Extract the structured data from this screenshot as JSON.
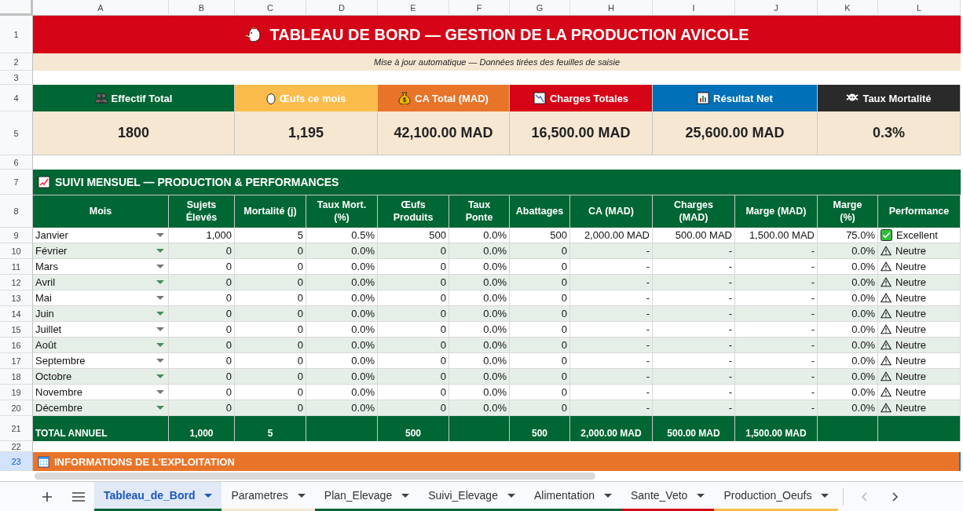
{
  "columns": [
    "A",
    "B",
    "C",
    "D",
    "E",
    "F",
    "G",
    "H",
    "I",
    "J",
    "K",
    "L"
  ],
  "row_numbers": [
    {
      "label": "1",
      "selected": false
    },
    {
      "label": "2",
      "selected": false
    },
    {
      "label": "3",
      "selected": false
    },
    {
      "label": "4",
      "selected": false
    },
    {
      "label": "5",
      "selected": false
    },
    {
      "label": "6",
      "selected": false
    },
    {
      "label": "7",
      "selected": false
    },
    {
      "label": "8",
      "selected": false
    },
    {
      "label": "9",
      "selected": false
    },
    {
      "label": "10",
      "selected": false
    },
    {
      "label": "11",
      "selected": false
    },
    {
      "label": "12",
      "selected": false
    },
    {
      "label": "13",
      "selected": false
    },
    {
      "label": "14",
      "selected": false
    },
    {
      "label": "15",
      "selected": false
    },
    {
      "label": "16",
      "selected": false
    },
    {
      "label": "17",
      "selected": false
    },
    {
      "label": "18",
      "selected": false
    },
    {
      "label": "19",
      "selected": false
    },
    {
      "label": "20",
      "selected": false
    },
    {
      "label": "21",
      "selected": false
    },
    {
      "label": "22",
      "selected": false
    },
    {
      "label": "23",
      "selected": true
    }
  ],
  "title": "TABLEAU DE BORD — GESTION DE LA PRODUCTION AVICOLE",
  "subtitle": "Mise à jour automatique — Données tirées des feuilles de saisie",
  "kpis": [
    {
      "label": "Effectif Total",
      "value": "1800",
      "color": "#006633"
    },
    {
      "label": "Œufs ce mois",
      "value": "1,195",
      "color": "#fbbc4c"
    },
    {
      "label": "CA Total (MAD)",
      "value": "42,100.00 MAD",
      "color": "#e8742a"
    },
    {
      "label": "Charges Totales",
      "value": "16,500.00 MAD",
      "color": "#d50416"
    },
    {
      "label": "Résultat Net",
      "value": "25,600.00 MAD",
      "color": "#0070b8"
    },
    {
      "label": "Taux Mortalité",
      "value": "0.3%",
      "color": "#2a2a2a"
    }
  ],
  "section_title": "SUIVI MENSUEL — PRODUCTION & PERFORMANCES",
  "table": {
    "columns": [
      "Mois",
      "Sujets Élevés",
      "Mortalité (j)",
      "Taux Mort. (%)",
      "Œufs Produits",
      "Taux Ponte",
      "Abattages",
      "CA (MAD)",
      "Charges (MAD)",
      "Marge (MAD)",
      "Marge (%)",
      "Performance"
    ],
    "rows": [
      {
        "cells": [
          "Janvier",
          "1,000",
          "5",
          "0.5%",
          "500",
          "0.0%",
          "500",
          "2,000.00 MAD",
          "500.00 MAD",
          "1,500.00 MAD",
          "75.0%"
        ],
        "performance": {
          "label": "Excellent",
          "kind": "excellent"
        }
      },
      {
        "cells": [
          "Février",
          "0",
          "0",
          "0.0%",
          "0",
          "0.0%",
          "0",
          "-",
          "-",
          "-",
          "0.0%"
        ],
        "performance": {
          "label": "Neutre",
          "kind": "neutral"
        }
      },
      {
        "cells": [
          "Mars",
          "0",
          "0",
          "0.0%",
          "0",
          "0.0%",
          "0",
          "-",
          "-",
          "-",
          "0.0%"
        ],
        "performance": {
          "label": "Neutre",
          "kind": "neutral"
        }
      },
      {
        "cells": [
          "Avril",
          "0",
          "0",
          "0.0%",
          "0",
          "0.0%",
          "0",
          "-",
          "-",
          "-",
          "0.0%"
        ],
        "performance": {
          "label": "Neutre",
          "kind": "neutral"
        }
      },
      {
        "cells": [
          "Mai",
          "0",
          "0",
          "0.0%",
          "0",
          "0.0%",
          "0",
          "-",
          "-",
          "-",
          "0.0%"
        ],
        "performance": {
          "label": "Neutre",
          "kind": "neutral"
        }
      },
      {
        "cells": [
          "Juin",
          "0",
          "0",
          "0.0%",
          "0",
          "0.0%",
          "0",
          "-",
          "-",
          "-",
          "0.0%"
        ],
        "performance": {
          "label": "Neutre",
          "kind": "neutral"
        }
      },
      {
        "cells": [
          "Juillet",
          "0",
          "0",
          "0.0%",
          "0",
          "0.0%",
          "0",
          "-",
          "-",
          "-",
          "0.0%"
        ],
        "performance": {
          "label": "Neutre",
          "kind": "neutral"
        }
      },
      {
        "cells": [
          "Août",
          "0",
          "0",
          "0.0%",
          "0",
          "0.0%",
          "0",
          "-",
          "-",
          "-",
          "0.0%"
        ],
        "performance": {
          "label": "Neutre",
          "kind": "neutral"
        }
      },
      {
        "cells": [
          "Septembre",
          "0",
          "0",
          "0.0%",
          "0",
          "0.0%",
          "0",
          "-",
          "-",
          "-",
          "0.0%"
        ],
        "performance": {
          "label": "Neutre",
          "kind": "neutral"
        }
      },
      {
        "cells": [
          "Octobre",
          "0",
          "0",
          "0.0%",
          "0",
          "0.0%",
          "0",
          "-",
          "-",
          "-",
          "0.0%"
        ],
        "performance": {
          "label": "Neutre",
          "kind": "neutral"
        }
      },
      {
        "cells": [
          "Novembre",
          "0",
          "0",
          "0.0%",
          "0",
          "0.0%",
          "0",
          "-",
          "-",
          "-",
          "0.0%"
        ],
        "performance": {
          "label": "Neutre",
          "kind": "neutral"
        }
      },
      {
        "cells": [
          "Décembre",
          "0",
          "0",
          "0.0%",
          "0",
          "0.0%",
          "0",
          "-",
          "-",
          "-",
          "0.0%"
        ],
        "performance": {
          "label": "Neutre",
          "kind": "neutral"
        }
      }
    ],
    "total": {
      "label": "TOTAL ANNUEL",
      "values": {
        "B": "1,000",
        "C": "5",
        "E": "500",
        "G": "500",
        "H": "2,000.00 MAD",
        "I": "500.00 MAD",
        "J": "1,500.00 MAD"
      }
    }
  },
  "info_title": "INFORMATIONS DE L'EXPLOITATION",
  "sheet_tabs": [
    {
      "label": "Tableau_de_Bord",
      "selected": true,
      "color": "#006633"
    },
    {
      "label": "Parametres",
      "selected": false,
      "color": "#f6e7d2"
    },
    {
      "label": "Plan_Elevage",
      "selected": false,
      "color": "#006633"
    },
    {
      "label": "Suivi_Elevage",
      "selected": false,
      "color": "#006633"
    },
    {
      "label": "Alimentation",
      "selected": false,
      "color": "#006633"
    },
    {
      "label": "Sante_Veto",
      "selected": false,
      "color": "#d50416"
    },
    {
      "label": "Production_Oeufs",
      "selected": false,
      "color": "#fbbc4c"
    }
  ]
}
